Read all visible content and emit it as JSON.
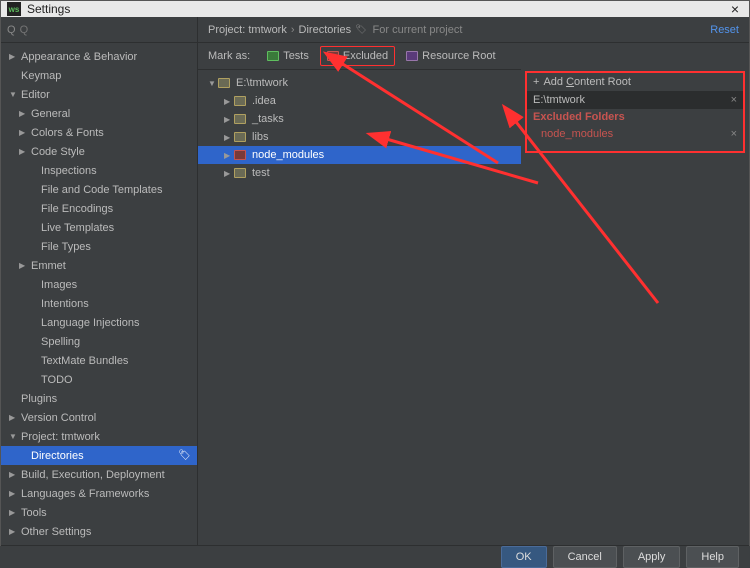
{
  "window": {
    "title": "Settings"
  },
  "search": {
    "placeholder": "Q"
  },
  "sidebar": {
    "items": [
      {
        "label": "Appearance & Behavior",
        "arrow": "right",
        "depth": 0
      },
      {
        "label": "Keymap",
        "arrow": "",
        "depth": 0
      },
      {
        "label": "Editor",
        "arrow": "down",
        "depth": 0
      },
      {
        "label": "General",
        "arrow": "right",
        "depth": 1
      },
      {
        "label": "Colors & Fonts",
        "arrow": "right",
        "depth": 1
      },
      {
        "label": "Code Style",
        "arrow": "right",
        "depth": 1
      },
      {
        "label": "Inspections",
        "arrow": "",
        "depth": 2
      },
      {
        "label": "File and Code Templates",
        "arrow": "",
        "depth": 2
      },
      {
        "label": "File Encodings",
        "arrow": "",
        "depth": 2
      },
      {
        "label": "Live Templates",
        "arrow": "",
        "depth": 2
      },
      {
        "label": "File Types",
        "arrow": "",
        "depth": 2
      },
      {
        "label": "Emmet",
        "arrow": "right",
        "depth": 1
      },
      {
        "label": "Images",
        "arrow": "",
        "depth": 2
      },
      {
        "label": "Intentions",
        "arrow": "",
        "depth": 2
      },
      {
        "label": "Language Injections",
        "arrow": "",
        "depth": 2
      },
      {
        "label": "Spelling",
        "arrow": "",
        "depth": 2
      },
      {
        "label": "TextMate Bundles",
        "arrow": "",
        "depth": 2
      },
      {
        "label": "TODO",
        "arrow": "",
        "depth": 2
      },
      {
        "label": "Plugins",
        "arrow": "",
        "depth": 0
      },
      {
        "label": "Version Control",
        "arrow": "right",
        "depth": 0
      },
      {
        "label": "Project: tmtwork",
        "arrow": "down",
        "depth": 0
      },
      {
        "label": "Directories",
        "arrow": "",
        "depth": 1,
        "selected": true,
        "gear": true
      },
      {
        "label": "Build, Execution, Deployment",
        "arrow": "right",
        "depth": 0
      },
      {
        "label": "Languages & Frameworks",
        "arrow": "right",
        "depth": 0
      },
      {
        "label": "Tools",
        "arrow": "right",
        "depth": 0
      },
      {
        "label": "Other Settings",
        "arrow": "right",
        "depth": 0
      }
    ]
  },
  "breadcrumb": {
    "project": "Project: tmtwork",
    "page": "Directories",
    "hint": "For current project",
    "reset": "Reset"
  },
  "markas": {
    "label": "Mark as:",
    "tests": "Tests",
    "excluded": "Excluded",
    "resource": "Resource Root"
  },
  "dirtree": {
    "root": "E:\\tmtwork",
    "children": [
      {
        "label": ".idea",
        "color": "plain"
      },
      {
        "label": "_tasks",
        "color": "plain"
      },
      {
        "label": "libs",
        "color": "plain"
      },
      {
        "label": "node_modules",
        "color": "red",
        "selected": true
      },
      {
        "label": "test",
        "color": "plain"
      }
    ]
  },
  "rightpanel": {
    "add": "Add Content Root",
    "path": "E:\\tmtwork",
    "excluded_header": "Excluded Folders",
    "excluded_item": "node_modules"
  },
  "footer": {
    "ok": "OK",
    "cancel": "Cancel",
    "apply": "Apply",
    "help": "Help"
  }
}
